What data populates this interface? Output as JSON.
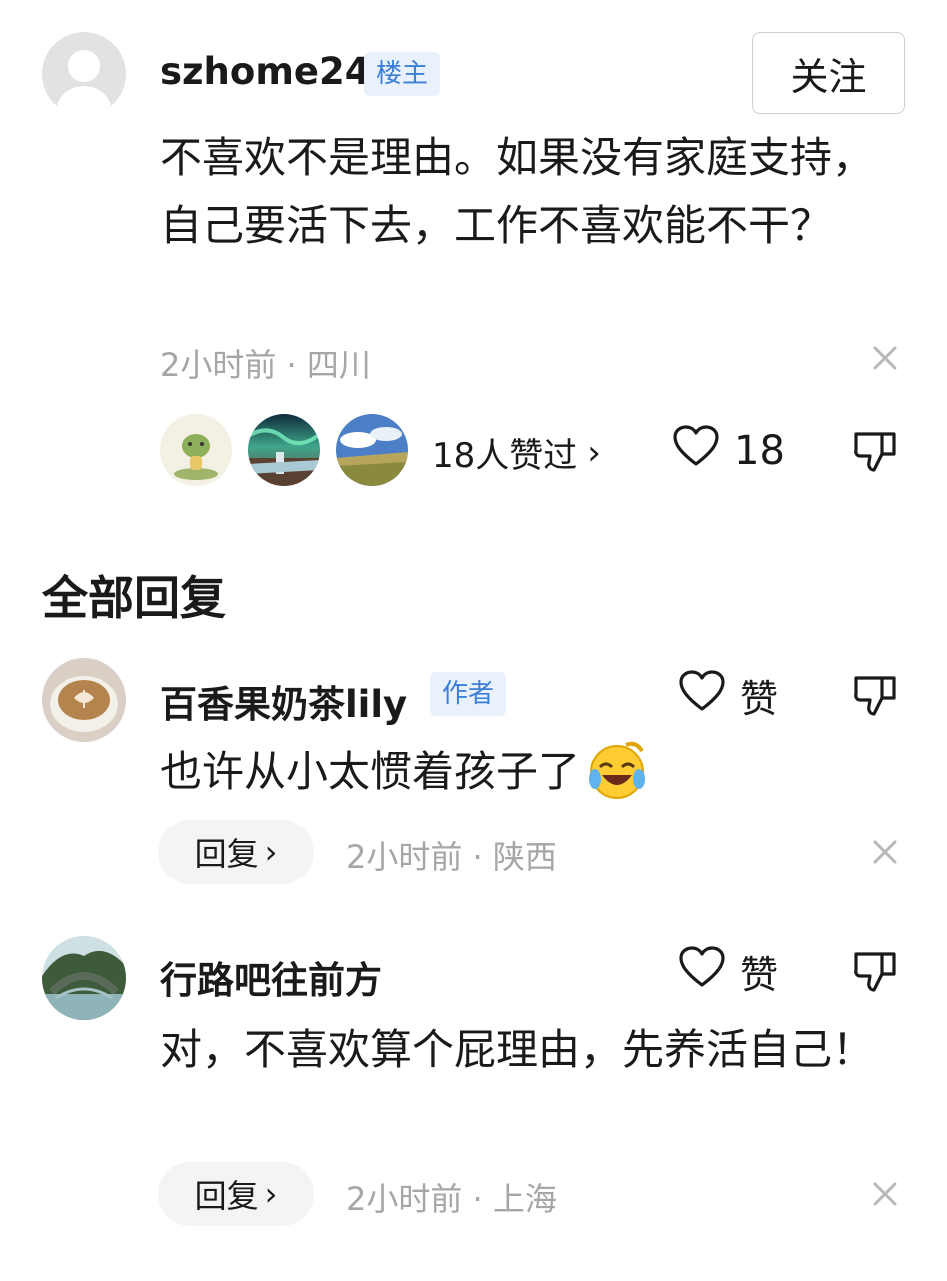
{
  "post": {
    "username": "szhome24",
    "badge": "楼主",
    "follow_label": "关注",
    "content": "不喜欢不是理由。如果没有家庭支持，自己要活下去，工作不喜欢能不干？",
    "meta": "2小时前 · 四川",
    "likers_text": "18人赞过",
    "likers_chevron": "›",
    "like_count": "18"
  },
  "section": {
    "title": "全部回复"
  },
  "replies": [
    {
      "username": "百香果奶茶lily",
      "badge": "作者",
      "like_label": "赞",
      "content": "也许从小太惯着孩子了",
      "reply_label": "回复",
      "reply_chevron": "›",
      "meta": "2小时前 · 陕西"
    },
    {
      "username": "行路吧往前方",
      "like_label": "赞",
      "content": "对，不喜欢算个屁理由，先养活自己！",
      "reply_label": "回复",
      "reply_chevron": "›",
      "meta": "2小时前 · 上海"
    }
  ],
  "icons": {
    "heart": "heart-icon",
    "thumbs_down": "thumbs-down-icon",
    "close": "close-icon",
    "emoji": "laughing-crying-emoji-icon"
  },
  "colors": {
    "badge_bg": "#e8f1fc",
    "badge_text": "#3b7fd6",
    "meta": "#a6a6a6",
    "reply_bg": "#f3f4f6"
  }
}
